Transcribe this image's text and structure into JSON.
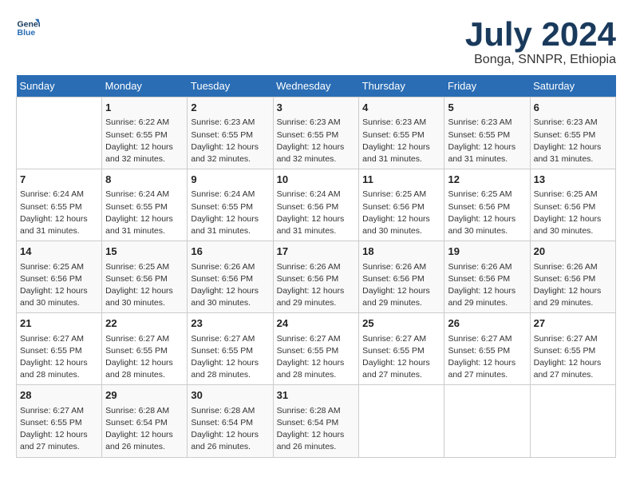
{
  "header": {
    "logo_line1": "General",
    "logo_line2": "Blue",
    "month": "July 2024",
    "location": "Bonga, SNNPR, Ethiopia"
  },
  "weekdays": [
    "Sunday",
    "Monday",
    "Tuesday",
    "Wednesday",
    "Thursday",
    "Friday",
    "Saturday"
  ],
  "weeks": [
    [
      {
        "day": "",
        "info": ""
      },
      {
        "day": "1",
        "info": "Sunrise: 6:22 AM\nSunset: 6:55 PM\nDaylight: 12 hours\nand 32 minutes."
      },
      {
        "day": "2",
        "info": "Sunrise: 6:23 AM\nSunset: 6:55 PM\nDaylight: 12 hours\nand 32 minutes."
      },
      {
        "day": "3",
        "info": "Sunrise: 6:23 AM\nSunset: 6:55 PM\nDaylight: 12 hours\nand 32 minutes."
      },
      {
        "day": "4",
        "info": "Sunrise: 6:23 AM\nSunset: 6:55 PM\nDaylight: 12 hours\nand 31 minutes."
      },
      {
        "day": "5",
        "info": "Sunrise: 6:23 AM\nSunset: 6:55 PM\nDaylight: 12 hours\nand 31 minutes."
      },
      {
        "day": "6",
        "info": "Sunrise: 6:23 AM\nSunset: 6:55 PM\nDaylight: 12 hours\nand 31 minutes."
      }
    ],
    [
      {
        "day": "7",
        "info": "Sunrise: 6:24 AM\nSunset: 6:55 PM\nDaylight: 12 hours\nand 31 minutes."
      },
      {
        "day": "8",
        "info": "Sunrise: 6:24 AM\nSunset: 6:55 PM\nDaylight: 12 hours\nand 31 minutes."
      },
      {
        "day": "9",
        "info": "Sunrise: 6:24 AM\nSunset: 6:55 PM\nDaylight: 12 hours\nand 31 minutes."
      },
      {
        "day": "10",
        "info": "Sunrise: 6:24 AM\nSunset: 6:56 PM\nDaylight: 12 hours\nand 31 minutes."
      },
      {
        "day": "11",
        "info": "Sunrise: 6:25 AM\nSunset: 6:56 PM\nDaylight: 12 hours\nand 30 minutes."
      },
      {
        "day": "12",
        "info": "Sunrise: 6:25 AM\nSunset: 6:56 PM\nDaylight: 12 hours\nand 30 minutes."
      },
      {
        "day": "13",
        "info": "Sunrise: 6:25 AM\nSunset: 6:56 PM\nDaylight: 12 hours\nand 30 minutes."
      }
    ],
    [
      {
        "day": "14",
        "info": "Sunrise: 6:25 AM\nSunset: 6:56 PM\nDaylight: 12 hours\nand 30 minutes."
      },
      {
        "day": "15",
        "info": "Sunrise: 6:25 AM\nSunset: 6:56 PM\nDaylight: 12 hours\nand 30 minutes."
      },
      {
        "day": "16",
        "info": "Sunrise: 6:26 AM\nSunset: 6:56 PM\nDaylight: 12 hours\nand 30 minutes."
      },
      {
        "day": "17",
        "info": "Sunrise: 6:26 AM\nSunset: 6:56 PM\nDaylight: 12 hours\nand 29 minutes."
      },
      {
        "day": "18",
        "info": "Sunrise: 6:26 AM\nSunset: 6:56 PM\nDaylight: 12 hours\nand 29 minutes."
      },
      {
        "day": "19",
        "info": "Sunrise: 6:26 AM\nSunset: 6:56 PM\nDaylight: 12 hours\nand 29 minutes."
      },
      {
        "day": "20",
        "info": "Sunrise: 6:26 AM\nSunset: 6:56 PM\nDaylight: 12 hours\nand 29 minutes."
      }
    ],
    [
      {
        "day": "21",
        "info": "Sunrise: 6:27 AM\nSunset: 6:55 PM\nDaylight: 12 hours\nand 28 minutes."
      },
      {
        "day": "22",
        "info": "Sunrise: 6:27 AM\nSunset: 6:55 PM\nDaylight: 12 hours\nand 28 minutes."
      },
      {
        "day": "23",
        "info": "Sunrise: 6:27 AM\nSunset: 6:55 PM\nDaylight: 12 hours\nand 28 minutes."
      },
      {
        "day": "24",
        "info": "Sunrise: 6:27 AM\nSunset: 6:55 PM\nDaylight: 12 hours\nand 28 minutes."
      },
      {
        "day": "25",
        "info": "Sunrise: 6:27 AM\nSunset: 6:55 PM\nDaylight: 12 hours\nand 27 minutes."
      },
      {
        "day": "26",
        "info": "Sunrise: 6:27 AM\nSunset: 6:55 PM\nDaylight: 12 hours\nand 27 minutes."
      },
      {
        "day": "27",
        "info": "Sunrise: 6:27 AM\nSunset: 6:55 PM\nDaylight: 12 hours\nand 27 minutes."
      }
    ],
    [
      {
        "day": "28",
        "info": "Sunrise: 6:27 AM\nSunset: 6:55 PM\nDaylight: 12 hours\nand 27 minutes."
      },
      {
        "day": "29",
        "info": "Sunrise: 6:28 AM\nSunset: 6:54 PM\nDaylight: 12 hours\nand 26 minutes."
      },
      {
        "day": "30",
        "info": "Sunrise: 6:28 AM\nSunset: 6:54 PM\nDaylight: 12 hours\nand 26 minutes."
      },
      {
        "day": "31",
        "info": "Sunrise: 6:28 AM\nSunset: 6:54 PM\nDaylight: 12 hours\nand 26 minutes."
      },
      {
        "day": "",
        "info": ""
      },
      {
        "day": "",
        "info": ""
      },
      {
        "day": "",
        "info": ""
      }
    ]
  ]
}
